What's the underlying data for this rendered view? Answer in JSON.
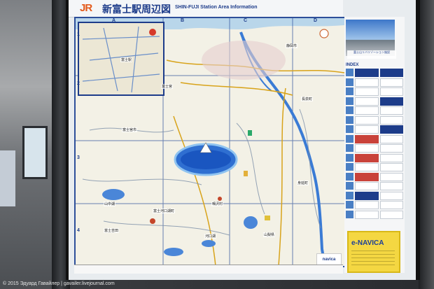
{
  "board": {
    "brand": "JR",
    "title_jp": "新富士駅周辺図",
    "title_en": "SHIN-FUJI Station Area Information"
  },
  "map": {
    "columns": [
      "A",
      "B",
      "C",
      "D"
    ],
    "rows": [
      "1",
      "2",
      "3",
      "4"
    ],
    "places": [
      {
        "id": "fuji-station",
        "text": "富士駅"
      },
      {
        "id": "kawamura",
        "text": "静岡市"
      },
      {
        "id": "numazu",
        "text": "長泉町"
      },
      {
        "id": "gotemba",
        "text": "富士宮市"
      },
      {
        "id": "fujinomiya",
        "text": "富士宮"
      },
      {
        "id": "fuji-lake",
        "text": "山中湖"
      },
      {
        "id": "kawaguchi",
        "text": "河口湖"
      },
      {
        "id": "yamanashi",
        "text": "山梨県"
      },
      {
        "id": "minobu",
        "text": "身延町"
      },
      {
        "id": "fujikawaguchiko",
        "text": "富士河口湖町"
      },
      {
        "id": "fujiyoshida",
        "text": "富士吉田"
      },
      {
        "id": "narusawa",
        "text": "鳴沢村"
      }
    ],
    "badge": "navica"
  },
  "sidebar": {
    "photo_caption": "富士山リバリゾーション施設",
    "index_title": "INDEX",
    "ad_brand": "e-NAVICA"
  },
  "credit": "© 2015 Эдуард Гавайлер | gavailer.livejournal.com",
  "colors": {
    "board_blue": "#1d3c8a",
    "lake": "#2f6fd1",
    "river": "#3a7bd5",
    "jr_orange": "#e35a1b"
  }
}
